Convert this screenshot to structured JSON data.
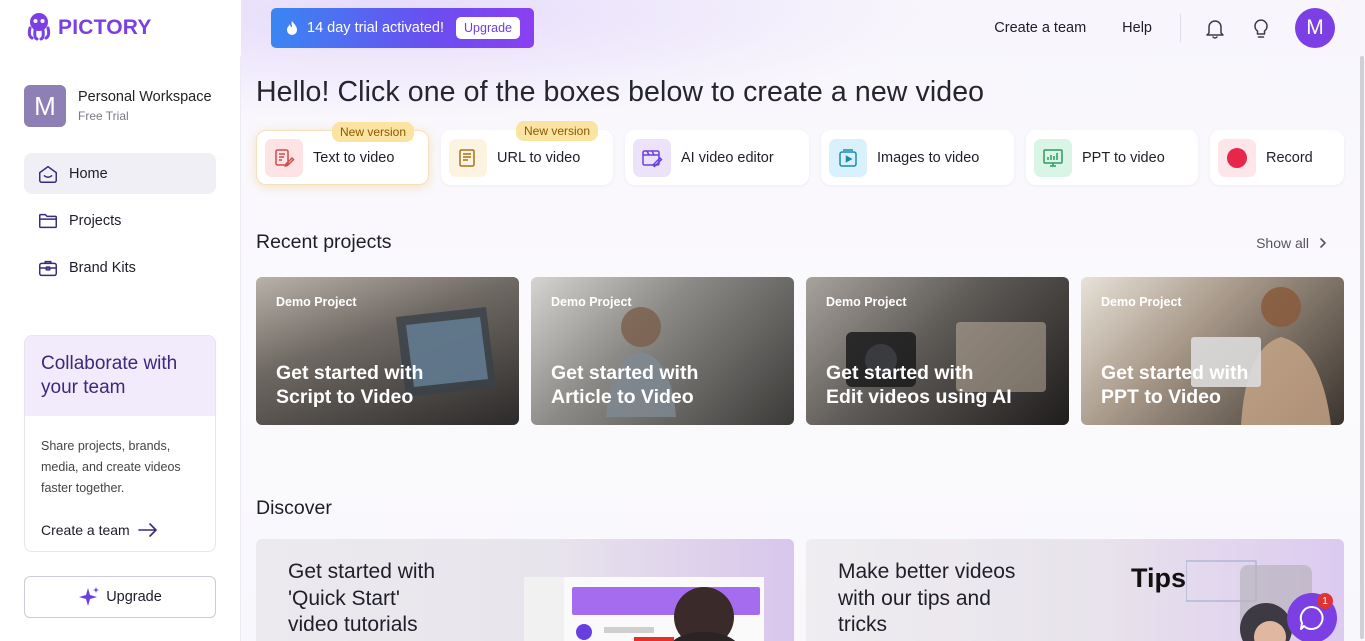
{
  "brand": {
    "name": "PICTORY",
    "accent": "#7b3fe4"
  },
  "workspace": {
    "initial": "M",
    "name": "Personal Workspace",
    "plan": "Free Trial"
  },
  "sidebar": {
    "items": [
      {
        "label": "Home",
        "icon": "home-icon",
        "active": true
      },
      {
        "label": "Projects",
        "icon": "folder-icon",
        "active": false
      },
      {
        "label": "Brand Kits",
        "icon": "briefcase-icon",
        "active": false
      }
    ],
    "collab": {
      "title_line1": "Collaborate with",
      "title_line2": "your team",
      "body_line1": "Share projects, brands,",
      "body_line2": "media, and create videos",
      "body_line3": "faster together.",
      "link": "Create a team"
    },
    "upgrade_label": "Upgrade"
  },
  "header": {
    "trial_text": "14 day trial activated!",
    "trial_button": "Upgrade",
    "create_team": "Create a team",
    "help": "Help",
    "avatar_initial": "M"
  },
  "main": {
    "headline": "Hello! Click one of the boxes below to create a new video",
    "create_options": [
      {
        "label": "Text to video",
        "badge": "New version",
        "icon": "text-video-icon"
      },
      {
        "label": "URL to video",
        "badge": "New version",
        "icon": "url-document-icon"
      },
      {
        "label": "AI video editor",
        "badge": "",
        "icon": "ai-editor-icon"
      },
      {
        "label": "Images to video",
        "badge": "",
        "icon": "images-video-icon"
      },
      {
        "label": "PPT to video",
        "badge": "",
        "icon": "ppt-chart-icon"
      },
      {
        "label": "Record",
        "badge": "",
        "icon": "record-icon"
      }
    ],
    "recent_title": "Recent projects",
    "show_all": "Show all",
    "projects": [
      {
        "tag": "Demo Project",
        "line1": "Get started with",
        "line2": "Script to Video"
      },
      {
        "tag": "Demo Project",
        "line1": "Get started with",
        "line2": "Article to Video"
      },
      {
        "tag": "Demo Project",
        "line1": "Get started with",
        "line2": "Edit videos using AI"
      },
      {
        "tag": "Demo Project",
        "line1": "Get started with",
        "line2": "PPT to Video"
      }
    ],
    "discover_title": "Discover",
    "discover": [
      {
        "line1": "Get started with",
        "line2": "'Quick Start'",
        "line3": "video tutorials"
      },
      {
        "line1": "Make better videos",
        "line2": "with our tips and",
        "line3": "tricks",
        "overlay": "Tips"
      }
    ]
  },
  "chat": {
    "count": "1",
    "icon": "chat-bubble-icon"
  }
}
